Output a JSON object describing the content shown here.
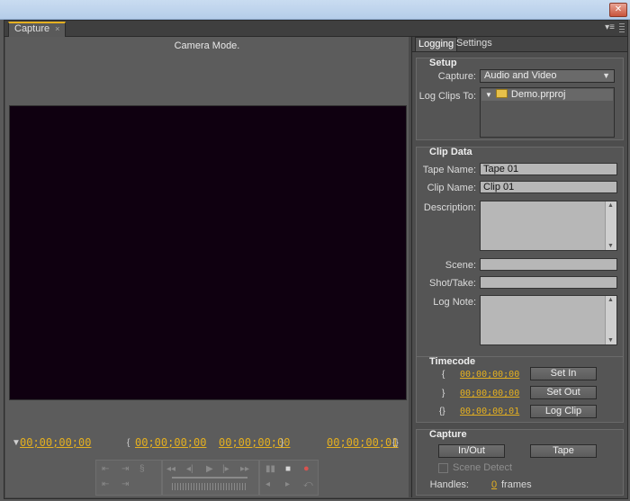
{
  "window": {
    "close_glyph": "✕"
  },
  "panel": {
    "tab_label": "Capture",
    "tab_close": "×",
    "menu_glyph": "▾≡"
  },
  "monitor": {
    "status": "Camera Mode.",
    "timecodes": {
      "current": "00;00;00;00",
      "in_point": "00;00;00;00",
      "out_point": "00;00;00;00",
      "duration": "00;00;00;01"
    }
  },
  "transport": {
    "glyphs": [
      "⇤",
      "⇥",
      "⇤",
      "⇥",
      "◂◂",
      "◂|",
      "▶",
      "|▸",
      "▸▸",
      "▮▮",
      "■",
      "●"
    ]
  },
  "tabs": {
    "logging": "Logging",
    "settings": "Settings"
  },
  "setup": {
    "header": "Setup",
    "capture_label": "Capture:",
    "capture_value": "Audio and Video",
    "log_clips_label": "Log Clips To:",
    "project_name": "Demo.prproj"
  },
  "clip_data": {
    "header": "Clip Data",
    "tape_name_label": "Tape Name:",
    "tape_name_value": "Tape 01",
    "clip_name_label": "Clip Name:",
    "clip_name_value": "Clip 01",
    "description_label": "Description:",
    "scene_label": "Scene:",
    "shot_take_label": "Shot/Take:",
    "log_note_label": "Log Note:"
  },
  "timecode": {
    "header": "Timecode",
    "in_value": "00;00;00;00",
    "out_value": "00;00;00;00",
    "dur_value": "00;00;00;01",
    "set_in": "Set In",
    "set_out": "Set Out",
    "log_clip": "Log Clip"
  },
  "capture": {
    "header": "Capture",
    "in_out": "In/Out",
    "tape": "Tape",
    "scene_detect": "Scene Detect",
    "handles_label": "Handles:",
    "handles_value": "0",
    "frames_label": "frames"
  }
}
